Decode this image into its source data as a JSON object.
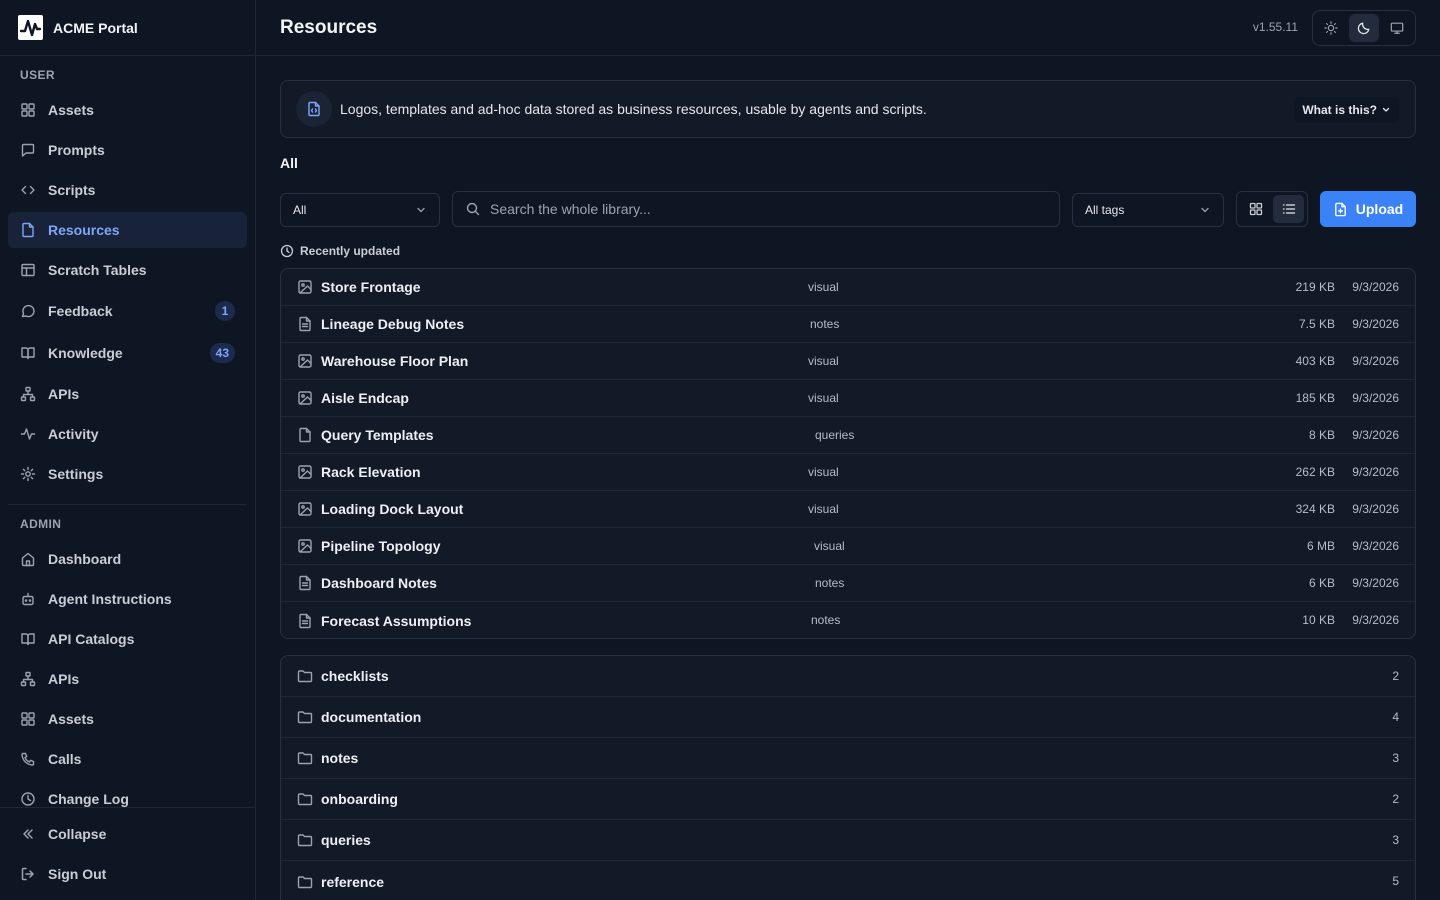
{
  "app": {
    "name": "ACME Portal",
    "version": "v1.55.11"
  },
  "sidebar": {
    "user_section": "USER",
    "user_items": [
      {
        "label": "Assets",
        "icon": "grid-icon"
      },
      {
        "label": "Prompts",
        "icon": "message-square-icon"
      },
      {
        "label": "Scripts",
        "icon": "code-icon"
      },
      {
        "label": "Resources",
        "icon": "file-icon",
        "active": true
      },
      {
        "label": "Scratch Tables",
        "icon": "table-icon"
      },
      {
        "label": "Feedback",
        "icon": "message-circle-icon",
        "badge": "1"
      },
      {
        "label": "Knowledge",
        "icon": "book-icon",
        "badge": "43"
      },
      {
        "label": "APIs",
        "icon": "network-icon"
      },
      {
        "label": "Activity",
        "icon": "activity-icon"
      },
      {
        "label": "Settings",
        "icon": "gear-icon"
      }
    ],
    "admin_section": "ADMIN",
    "admin_items": [
      {
        "label": "Dashboard",
        "icon": "home-icon"
      },
      {
        "label": "Agent Instructions",
        "icon": "bot-icon"
      },
      {
        "label": "API Catalogs",
        "icon": "book-icon"
      },
      {
        "label": "APIs",
        "icon": "network-icon"
      },
      {
        "label": "Assets",
        "icon": "grid-icon"
      },
      {
        "label": "Calls",
        "icon": "phone-icon"
      },
      {
        "label": "Change Log",
        "icon": "clock-icon"
      }
    ],
    "footer": {
      "collapse": "Collapse",
      "sign_out": "Sign Out"
    }
  },
  "header": {
    "title": "Resources"
  },
  "banner": {
    "text": "Logos, templates and ad-hoc data stored as business resources, usable by agents and scripts.",
    "help": "What is this?"
  },
  "filters": {
    "section": "All",
    "type_select": "All",
    "search_placeholder": "Search the whole library...",
    "tags_select": "All tags",
    "upload": "Upload",
    "recent_label": "Recently updated"
  },
  "resources": [
    {
      "name": "Store Frontage",
      "tag": "visual",
      "size": "219 KB",
      "date": "9/3/2026",
      "icon": "image-icon"
    },
    {
      "name": "Lineage Debug Notes",
      "tag": "notes",
      "size": "7.5 KB",
      "date": "9/3/2026",
      "icon": "document-icon"
    },
    {
      "name": "Warehouse Floor Plan",
      "tag": "visual",
      "size": "403 KB",
      "date": "9/3/2026",
      "icon": "image-icon"
    },
    {
      "name": "Aisle Endcap",
      "tag": "visual",
      "size": "185 KB",
      "date": "9/3/2026",
      "icon": "image-icon"
    },
    {
      "name": "Query Templates",
      "tag": "queries",
      "size": "8 KB",
      "date": "9/3/2026",
      "icon": "file-icon"
    },
    {
      "name": "Rack Elevation",
      "tag": "visual",
      "size": "262 KB",
      "date": "9/3/2026",
      "icon": "image-icon"
    },
    {
      "name": "Loading Dock Layout",
      "tag": "visual",
      "size": "324 KB",
      "date": "9/3/2026",
      "icon": "image-icon"
    },
    {
      "name": "Pipeline Topology",
      "tag": "visual",
      "size": "6 MB",
      "date": "9/3/2026",
      "icon": "image-icon"
    },
    {
      "name": "Dashboard Notes",
      "tag": "notes",
      "size": "6 KB",
      "date": "9/3/2026",
      "icon": "document-icon"
    },
    {
      "name": "Forecast Assumptions",
      "tag": "notes",
      "size": "10 KB",
      "date": "9/3/2026",
      "icon": "document-icon"
    }
  ],
  "folders": [
    {
      "name": "checklists",
      "count": "2"
    },
    {
      "name": "documentation",
      "count": "4"
    },
    {
      "name": "notes",
      "count": "3"
    },
    {
      "name": "onboarding",
      "count": "2"
    },
    {
      "name": "queries",
      "count": "3"
    },
    {
      "name": "reference",
      "count": "5"
    }
  ],
  "colors": {
    "accent": "#3b82f6",
    "active_text": "#7ea6f8",
    "background": "#0f1623"
  }
}
